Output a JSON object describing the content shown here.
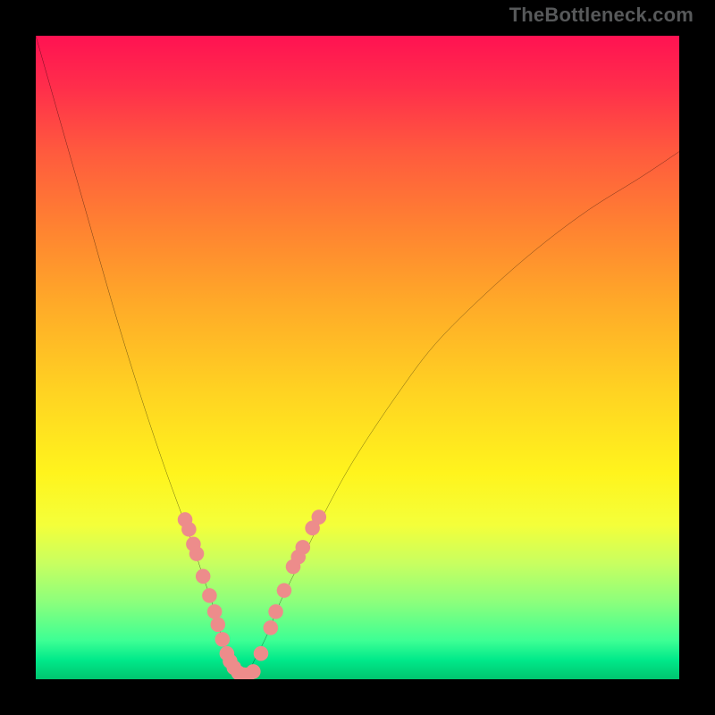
{
  "watermark": {
    "text": "TheBottleneck.com"
  },
  "chart_data": {
    "type": "line",
    "title": "",
    "xlabel": "",
    "ylabel": "",
    "xlim": [
      0,
      100
    ],
    "ylim": [
      0,
      100
    ],
    "x": [
      0,
      4,
      8,
      12,
      16,
      20,
      24,
      26,
      28,
      29,
      30,
      31,
      32,
      33,
      34,
      36,
      38,
      42,
      46,
      50,
      56,
      62,
      70,
      78,
      86,
      94,
      100
    ],
    "bottleneck_pct": [
      100,
      86,
      72,
      58,
      45,
      33,
      22,
      16,
      10,
      6,
      3,
      1,
      0,
      1,
      3,
      7,
      12,
      20,
      28,
      35,
      44,
      52,
      60,
      67,
      73,
      78,
      82
    ],
    "curve_minimum_x": 32,
    "curve_minimum_y": 0,
    "left_marker_cluster": {
      "color": "#ed8c8b",
      "points": [
        {
          "x": 23.2,
          "y": 24.8
        },
        {
          "x": 23.8,
          "y": 23.3
        },
        {
          "x": 24.5,
          "y": 21.0
        },
        {
          "x": 25.0,
          "y": 19.5
        },
        {
          "x": 26.0,
          "y": 16.0
        },
        {
          "x": 27.0,
          "y": 13.0
        },
        {
          "x": 27.8,
          "y": 10.5
        },
        {
          "x": 28.3,
          "y": 8.5
        },
        {
          "x": 29.0,
          "y": 6.2
        },
        {
          "x": 29.7,
          "y": 4.0
        },
        {
          "x": 30.2,
          "y": 2.8
        },
        {
          "x": 30.8,
          "y": 1.8
        },
        {
          "x": 31.5,
          "y": 1.0
        },
        {
          "x": 32.3,
          "y": 0.7
        }
      ]
    },
    "right_marker_cluster": {
      "color": "#ed8c8b",
      "points": [
        {
          "x": 33.0,
          "y": 0.7
        },
        {
          "x": 33.8,
          "y": 1.2
        },
        {
          "x": 35.0,
          "y": 4.0
        },
        {
          "x": 36.5,
          "y": 8.0
        },
        {
          "x": 37.3,
          "y": 10.5
        },
        {
          "x": 38.6,
          "y": 13.8
        },
        {
          "x": 40.0,
          "y": 17.5
        },
        {
          "x": 40.8,
          "y": 19.0
        },
        {
          "x": 41.5,
          "y": 20.5
        },
        {
          "x": 43.0,
          "y": 23.5
        },
        {
          "x": 44.0,
          "y": 25.2
        }
      ]
    }
  }
}
